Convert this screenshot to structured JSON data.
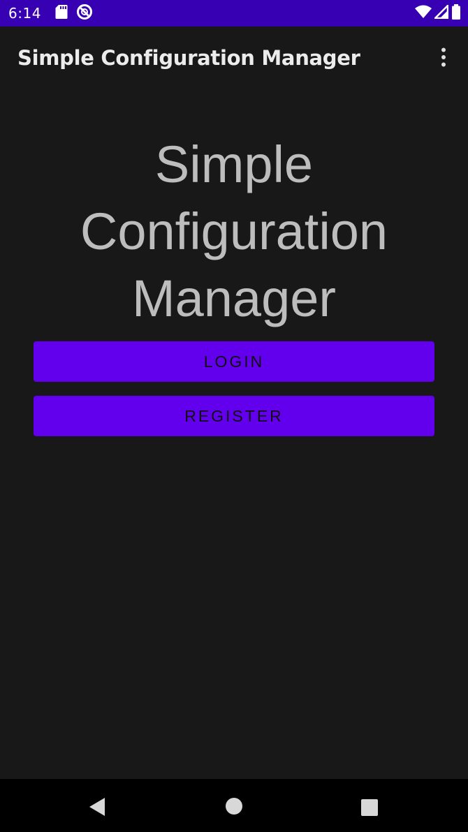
{
  "status_bar": {
    "time": "6:14",
    "background": "#3700b3",
    "icons_left": [
      "sd-card-icon",
      "no-disturb-icon"
    ],
    "icons_right": [
      "wifi-icon",
      "signal-icon",
      "battery-icon"
    ]
  },
  "toolbar": {
    "title": "Simple Configuration Manager",
    "overflow_icon": "more-vert-icon"
  },
  "main": {
    "hero_lines": [
      "Simple",
      "Configuration",
      "Manager"
    ],
    "login_label": "LOGIN",
    "register_label": "REGISTER",
    "accent_color": "#6200ee"
  },
  "nav_bar": {
    "icons": [
      "back-icon",
      "home-icon",
      "recents-icon"
    ]
  }
}
